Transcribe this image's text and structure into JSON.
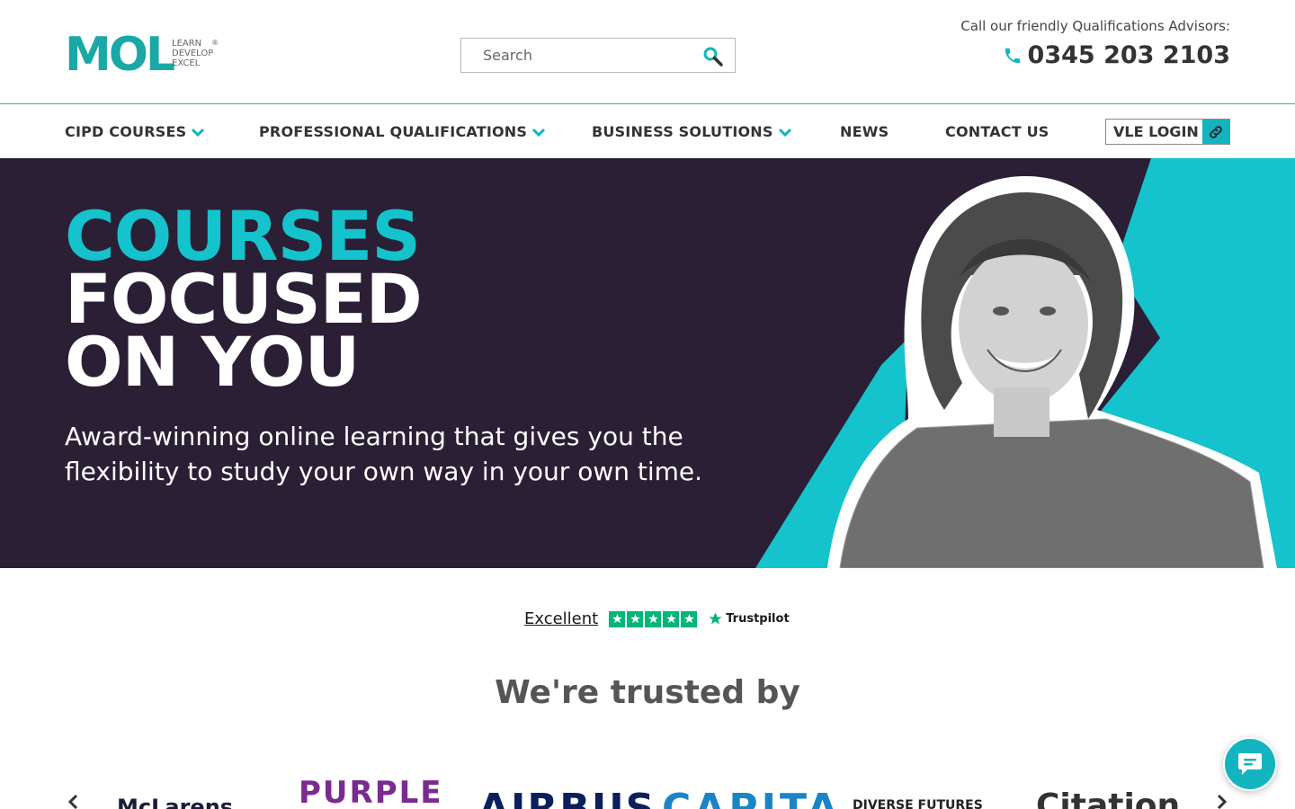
{
  "header": {
    "logo": {
      "mark": "MOL",
      "tagline": [
        "LEARN",
        "DEVELOP",
        "EXCEL"
      ],
      "registered": "®"
    },
    "search": {
      "placeholder": "Search"
    },
    "advisor_label": "Call our friendly Qualifications Advisors:",
    "phone": "0345 203 2103"
  },
  "nav": {
    "items": [
      {
        "label": "CIPD COURSES",
        "dropdown": true
      },
      {
        "label": "PROFESSIONAL QUALIFICATIONS",
        "dropdown": true
      },
      {
        "label": "BUSINESS SOLUTIONS",
        "dropdown": true
      },
      {
        "label": "NEWS",
        "dropdown": false
      },
      {
        "label": "CONTACT US",
        "dropdown": false
      }
    ],
    "vle_login": "VLE LOGIN"
  },
  "hero": {
    "title_line1": "COURSES",
    "title_line2": "FOCUSED",
    "title_line3": "ON YOU",
    "subtitle": "Award-winning online learning that gives you the flexibility to study your own way in your own time."
  },
  "trustpilot": {
    "rating_text": "Excellent",
    "stars": 5,
    "brand": "Trustpilot"
  },
  "trusted_heading": "We're trusted by",
  "clients": [
    "McLarens",
    "PURPLE",
    "AIRBUS",
    "CAPITA",
    "DIVERSE FUTURES",
    "Citation"
  ],
  "colors": {
    "accent": "#14c3cc",
    "hero_bg": "#2b1f35",
    "trustpilot_green": "#00b67a"
  },
  "icons": {
    "search": "search-icon",
    "phone": "phone-icon",
    "chevron": "chevron-down-icon",
    "link": "link-icon",
    "chat": "chat-icon",
    "prev": "chevron-left-icon",
    "next": "chevron-right-icon"
  }
}
